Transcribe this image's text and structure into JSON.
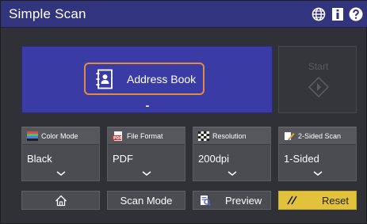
{
  "header": {
    "title": "Simple Scan",
    "icons": [
      "globe-icon",
      "info-icon",
      "help-icon"
    ]
  },
  "destination": {
    "address_book_label": "Address Book",
    "selected_count": "-"
  },
  "start": {
    "label": "Start",
    "enabled": false
  },
  "settings": [
    {
      "label": "Color Mode",
      "value": "Black",
      "icon": "color-mode-icon"
    },
    {
      "label": "File Format",
      "value": "PDF",
      "icon": "pdf-file-icon"
    },
    {
      "label": "Resolution",
      "value": "200dpi",
      "icon": "resolution-icon"
    },
    {
      "label": "2-Sided Scan",
      "value": "1-Sided",
      "icon": "two-sided-scan-icon"
    }
  ],
  "bottom_bar": {
    "home_icon": "home-icon",
    "scan_mode_label": "Scan Mode",
    "preview_label": "Preview",
    "reset_label": "Reset"
  },
  "colors": {
    "title_bar": "#32357e",
    "destination_panel": "#3b3ba6",
    "highlight_border": "#e38b41",
    "reset_button": "#e2c23a"
  }
}
